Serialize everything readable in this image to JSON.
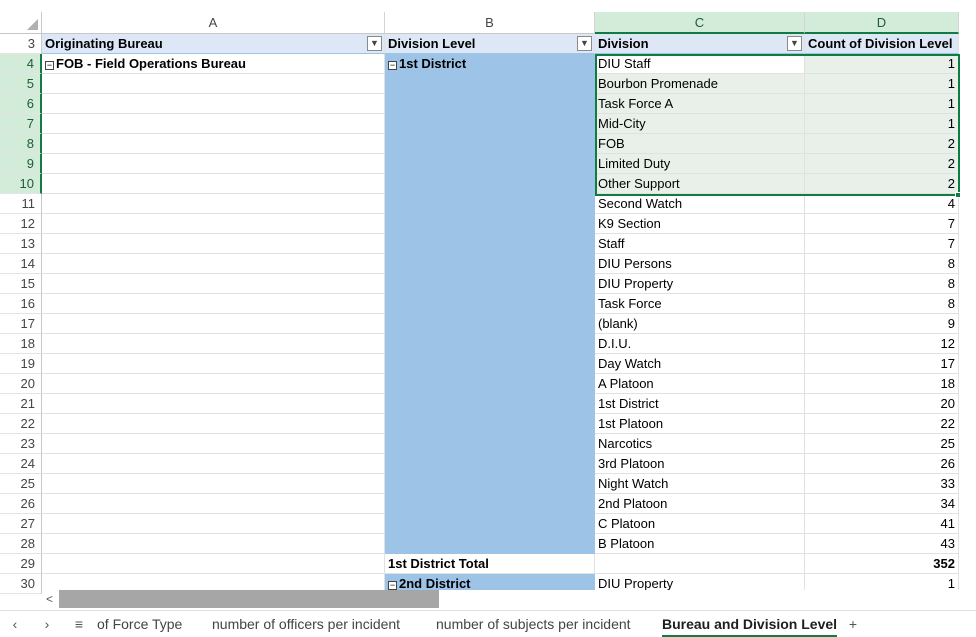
{
  "columns": [
    "A",
    "B",
    "C",
    "D"
  ],
  "pivot": {
    "header_row": "3",
    "header": {
      "a": "Originating Bureau",
      "b": "Division Level",
      "c": "Division",
      "d": "Count of Division Level"
    },
    "bureau": "FOB - Field Operations Bureau",
    "district": "1st District",
    "rows": [
      {
        "row": "4",
        "division": "DIU Staff",
        "count": "1"
      },
      {
        "row": "5",
        "division": "Bourbon Promenade",
        "count": "1"
      },
      {
        "row": "6",
        "division": "Task Force A",
        "count": "1"
      },
      {
        "row": "7",
        "division": "Mid-City",
        "count": "1"
      },
      {
        "row": "8",
        "division": "FOB",
        "count": "2"
      },
      {
        "row": "9",
        "division": "Limited Duty",
        "count": "2"
      },
      {
        "row": "10",
        "division": "Other Support",
        "count": "2"
      },
      {
        "row": "11",
        "division": "Second Watch",
        "count": "4"
      },
      {
        "row": "12",
        "division": "K9 Section",
        "count": "7"
      },
      {
        "row": "13",
        "division": "Staff",
        "count": "7"
      },
      {
        "row": "14",
        "division": "DIU Persons",
        "count": "8"
      },
      {
        "row": "15",
        "division": "DIU Property",
        "count": "8"
      },
      {
        "row": "16",
        "division": "Task Force",
        "count": "8"
      },
      {
        "row": "17",
        "division": "(blank)",
        "count": "9"
      },
      {
        "row": "18",
        "division": "D.I.U.",
        "count": "12"
      },
      {
        "row": "19",
        "division": "Day Watch",
        "count": "17"
      },
      {
        "row": "20",
        "division": "A Platoon",
        "count": "18"
      },
      {
        "row": "21",
        "division": "1st District",
        "count": "20"
      },
      {
        "row": "22",
        "division": "1st Platoon",
        "count": "22"
      },
      {
        "row": "23",
        "division": "Narcotics",
        "count": "25"
      },
      {
        "row": "24",
        "division": "3rd Platoon",
        "count": "26"
      },
      {
        "row": "25",
        "division": "Night Watch",
        "count": "33"
      },
      {
        "row": "26",
        "division": "2nd Platoon",
        "count": "34"
      },
      {
        "row": "27",
        "division": "C Platoon",
        "count": "41"
      },
      {
        "row": "28",
        "division": "B Platoon",
        "count": "43"
      }
    ],
    "total_row": {
      "row": "29",
      "label": "1st District Total",
      "value": "352"
    },
    "next_row": {
      "row": "30",
      "district": "2nd District",
      "division": "DIU Property",
      "count": "1"
    }
  },
  "sheet_tabs": {
    "tab_1": "of Force Type",
    "tab_2": "number of officers per incident",
    "tab_3": "number of subjects per incident",
    "tab_4_active": "Bureau and Division Level",
    "add": "+"
  },
  "nav": {
    "prev": "‹",
    "next": "›",
    "menu": "≡",
    "scroll_left": "<"
  },
  "icons": {
    "collapse": "⊟",
    "dropdown": "filter-dropdown-icon"
  },
  "colors": {
    "accent": "#107c41",
    "pivot_blue": "#9dc3e6",
    "header_fill": "#dde7f5"
  }
}
